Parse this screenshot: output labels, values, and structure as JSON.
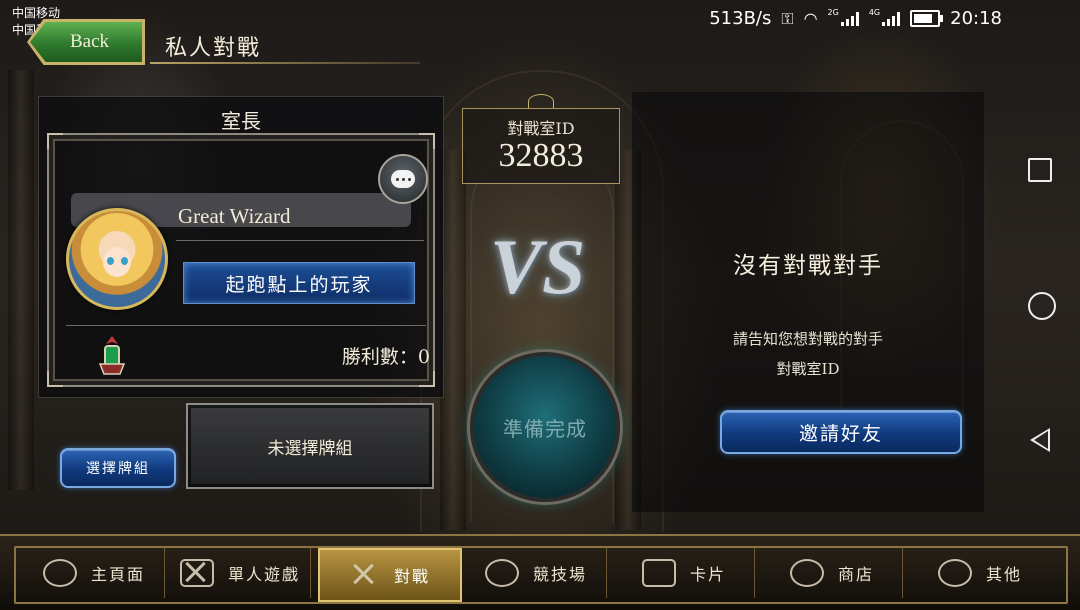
{
  "status_bar": {
    "carrier_1": "中国移动",
    "carrier_2": "中国移动",
    "net_speed": "513B/s",
    "net_type_1": "2G",
    "net_type_2": "4G",
    "time": "20:18"
  },
  "header": {
    "back_label": "Back",
    "page_title": "私人對戰"
  },
  "host": {
    "section_title": "室長",
    "player_name": "Great Wizard",
    "player_title": "起跑點上的玩家",
    "wins_label": "勝利數：0",
    "deck_status": "未選擇牌組",
    "select_deck_label": "選擇牌組"
  },
  "room": {
    "label": "對戰室ID",
    "id": "32883",
    "vs": "VS",
    "ready_label": "準備完成"
  },
  "opponent": {
    "no_opponent": "沒有對戰對手",
    "hint_line1": "請告知您想對戰的對手",
    "hint_line2": "對戰室ID",
    "invite_label": "邀請好友"
  },
  "nav": {
    "items": [
      {
        "label": "主頁面",
        "icon": "home-icon"
      },
      {
        "label": "單人遊戲",
        "icon": "sword-shield-icon"
      },
      {
        "label": "對戰",
        "icon": "crossed-swords-icon",
        "active": true
      },
      {
        "label": "競技場",
        "icon": "arena-emblem-icon"
      },
      {
        "label": "卡片",
        "icon": "cards-icon"
      },
      {
        "label": "商店",
        "icon": "shop-icon"
      },
      {
        "label": "其他",
        "icon": "more-icon"
      }
    ]
  }
}
